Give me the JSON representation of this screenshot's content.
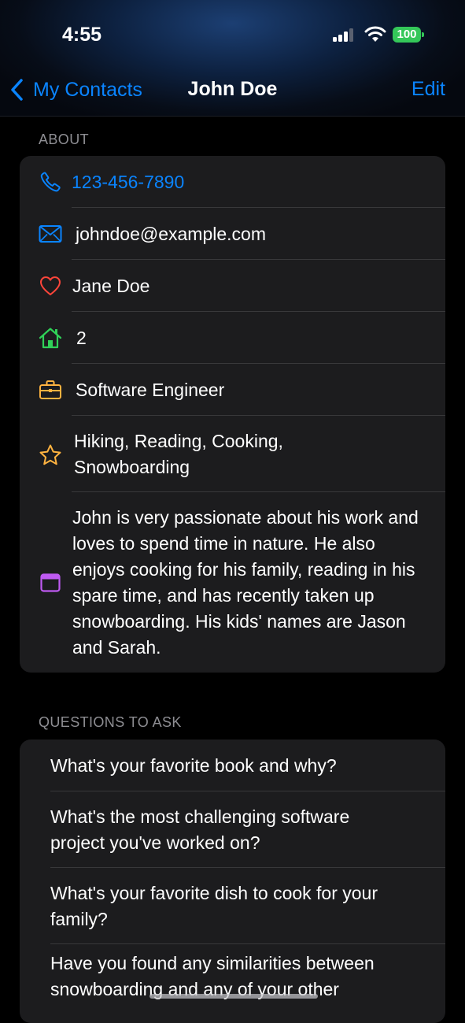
{
  "status_bar": {
    "time": "4:55",
    "battery": "100"
  },
  "nav": {
    "back_label": "My Contacts",
    "title": "John Doe",
    "edit_label": "Edit"
  },
  "about": {
    "section_label": "ABOUT",
    "phone": "123-456-7890",
    "email": "johndoe@example.com",
    "partner": "Jane Doe",
    "kids": "2",
    "occupation": "Software Engineer",
    "hobbies": "Hiking, Reading, Cooking, Snowboarding",
    "notes": "John is very passionate about his work and loves to spend time in nature. He also enjoys cooking for his family, reading in his spare time, and has recently taken up snowboarding. His kids' names are Jason and Sarah."
  },
  "questions": {
    "section_label": "QUESTIONS TO ASK",
    "items": [
      "What's your favorite book and why?",
      "What's the most challenging software project you've worked on?",
      "What's your favorite dish to cook for your family?",
      "Have you found any similarities between snowboarding and any of your other"
    ]
  },
  "colors": {
    "accent": "#0a84ff",
    "heart": "#ff453a",
    "home": "#30d158",
    "work": "#ffb340",
    "star": "#ffb340",
    "notes": "#bf5af2",
    "battery": "#34c759"
  },
  "icons": [
    "phone-icon",
    "envelope-icon",
    "heart-icon",
    "house-icon",
    "briefcase-icon",
    "star-icon",
    "calendar-icon"
  ]
}
